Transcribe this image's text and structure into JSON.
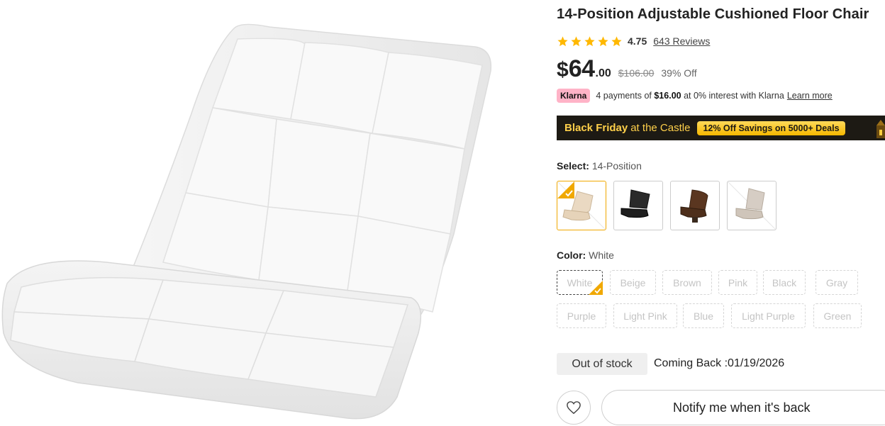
{
  "product": {
    "title": "14-Position Adjustable Cushioned Floor Chair",
    "rating": "4.75",
    "star_count": 5,
    "reviews_label": "643 Reviews",
    "price": {
      "currency": "$",
      "whole": "64",
      "cents": ".00",
      "original": "$106.00",
      "discount": "39% Off"
    }
  },
  "klarna": {
    "badge": "Klarna",
    "text_before": "4 payments of",
    "amount": "$16.00",
    "text_after": "at 0% interest with Klarna",
    "learn_more": "Learn more"
  },
  "promo": {
    "highlight": "Black Friday",
    "rest": "at the Castle",
    "deal": "12% Off Savings on 5000+ Deals"
  },
  "select": {
    "label": "Select:",
    "value": "14-Position",
    "options": [
      {
        "name": "beige-chair",
        "selected": true
      },
      {
        "name": "black-chair",
        "selected": false
      },
      {
        "name": "brown-chair",
        "selected": false
      },
      {
        "name": "gray-chair",
        "selected": false
      }
    ]
  },
  "color": {
    "label": "Color:",
    "value": "White",
    "options": [
      "White",
      "Beige",
      "Brown",
      "Pink",
      "Black",
      "Gray",
      "Purple",
      "Light Pink",
      "Blue",
      "Light Purple",
      "Green"
    ]
  },
  "stock": {
    "status": "Out of stock",
    "coming_back": "Coming Back :01/19/2026"
  },
  "actions": {
    "notify": "Notify me when it's back"
  },
  "colors": {
    "star": "#ffb800",
    "accent": "#f0a800",
    "promo_bg": "#1d1a14",
    "promo_text": "#ffd04a",
    "klarna_pink": "#ffb3c7"
  }
}
